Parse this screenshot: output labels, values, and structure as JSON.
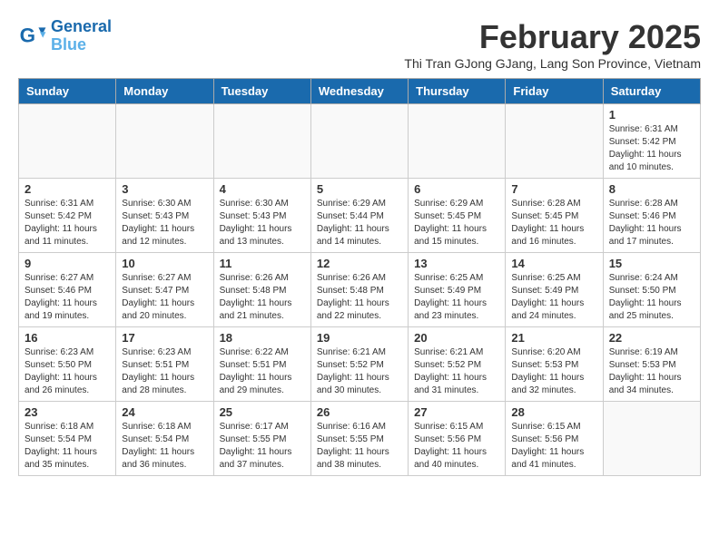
{
  "logo": {
    "line1": "General",
    "line2": "Blue"
  },
  "title": "February 2025",
  "subtitle": "Thi Tran GJong GJang, Lang Son Province, Vietnam",
  "days_of_week": [
    "Sunday",
    "Monday",
    "Tuesday",
    "Wednesday",
    "Thursday",
    "Friday",
    "Saturday"
  ],
  "weeks": [
    [
      {
        "day": "",
        "info": ""
      },
      {
        "day": "",
        "info": ""
      },
      {
        "day": "",
        "info": ""
      },
      {
        "day": "",
        "info": ""
      },
      {
        "day": "",
        "info": ""
      },
      {
        "day": "",
        "info": ""
      },
      {
        "day": "1",
        "info": "Sunrise: 6:31 AM\nSunset: 5:42 PM\nDaylight: 11 hours and 10 minutes."
      }
    ],
    [
      {
        "day": "2",
        "info": "Sunrise: 6:31 AM\nSunset: 5:42 PM\nDaylight: 11 hours and 11 minutes."
      },
      {
        "day": "3",
        "info": "Sunrise: 6:30 AM\nSunset: 5:43 PM\nDaylight: 11 hours and 12 minutes."
      },
      {
        "day": "4",
        "info": "Sunrise: 6:30 AM\nSunset: 5:43 PM\nDaylight: 11 hours and 13 minutes."
      },
      {
        "day": "5",
        "info": "Sunrise: 6:29 AM\nSunset: 5:44 PM\nDaylight: 11 hours and 14 minutes."
      },
      {
        "day": "6",
        "info": "Sunrise: 6:29 AM\nSunset: 5:45 PM\nDaylight: 11 hours and 15 minutes."
      },
      {
        "day": "7",
        "info": "Sunrise: 6:28 AM\nSunset: 5:45 PM\nDaylight: 11 hours and 16 minutes."
      },
      {
        "day": "8",
        "info": "Sunrise: 6:28 AM\nSunset: 5:46 PM\nDaylight: 11 hours and 17 minutes."
      }
    ],
    [
      {
        "day": "9",
        "info": "Sunrise: 6:27 AM\nSunset: 5:46 PM\nDaylight: 11 hours and 19 minutes."
      },
      {
        "day": "10",
        "info": "Sunrise: 6:27 AM\nSunset: 5:47 PM\nDaylight: 11 hours and 20 minutes."
      },
      {
        "day": "11",
        "info": "Sunrise: 6:26 AM\nSunset: 5:48 PM\nDaylight: 11 hours and 21 minutes."
      },
      {
        "day": "12",
        "info": "Sunrise: 6:26 AM\nSunset: 5:48 PM\nDaylight: 11 hours and 22 minutes."
      },
      {
        "day": "13",
        "info": "Sunrise: 6:25 AM\nSunset: 5:49 PM\nDaylight: 11 hours and 23 minutes."
      },
      {
        "day": "14",
        "info": "Sunrise: 6:25 AM\nSunset: 5:49 PM\nDaylight: 11 hours and 24 minutes."
      },
      {
        "day": "15",
        "info": "Sunrise: 6:24 AM\nSunset: 5:50 PM\nDaylight: 11 hours and 25 minutes."
      }
    ],
    [
      {
        "day": "16",
        "info": "Sunrise: 6:23 AM\nSunset: 5:50 PM\nDaylight: 11 hours and 26 minutes."
      },
      {
        "day": "17",
        "info": "Sunrise: 6:23 AM\nSunset: 5:51 PM\nDaylight: 11 hours and 28 minutes."
      },
      {
        "day": "18",
        "info": "Sunrise: 6:22 AM\nSunset: 5:51 PM\nDaylight: 11 hours and 29 minutes."
      },
      {
        "day": "19",
        "info": "Sunrise: 6:21 AM\nSunset: 5:52 PM\nDaylight: 11 hours and 30 minutes."
      },
      {
        "day": "20",
        "info": "Sunrise: 6:21 AM\nSunset: 5:52 PM\nDaylight: 11 hours and 31 minutes."
      },
      {
        "day": "21",
        "info": "Sunrise: 6:20 AM\nSunset: 5:53 PM\nDaylight: 11 hours and 32 minutes."
      },
      {
        "day": "22",
        "info": "Sunrise: 6:19 AM\nSunset: 5:53 PM\nDaylight: 11 hours and 34 minutes."
      }
    ],
    [
      {
        "day": "23",
        "info": "Sunrise: 6:18 AM\nSunset: 5:54 PM\nDaylight: 11 hours and 35 minutes."
      },
      {
        "day": "24",
        "info": "Sunrise: 6:18 AM\nSunset: 5:54 PM\nDaylight: 11 hours and 36 minutes."
      },
      {
        "day": "25",
        "info": "Sunrise: 6:17 AM\nSunset: 5:55 PM\nDaylight: 11 hours and 37 minutes."
      },
      {
        "day": "26",
        "info": "Sunrise: 6:16 AM\nSunset: 5:55 PM\nDaylight: 11 hours and 38 minutes."
      },
      {
        "day": "27",
        "info": "Sunrise: 6:15 AM\nSunset: 5:56 PM\nDaylight: 11 hours and 40 minutes."
      },
      {
        "day": "28",
        "info": "Sunrise: 6:15 AM\nSunset: 5:56 PM\nDaylight: 11 hours and 41 minutes."
      },
      {
        "day": "",
        "info": ""
      }
    ]
  ]
}
